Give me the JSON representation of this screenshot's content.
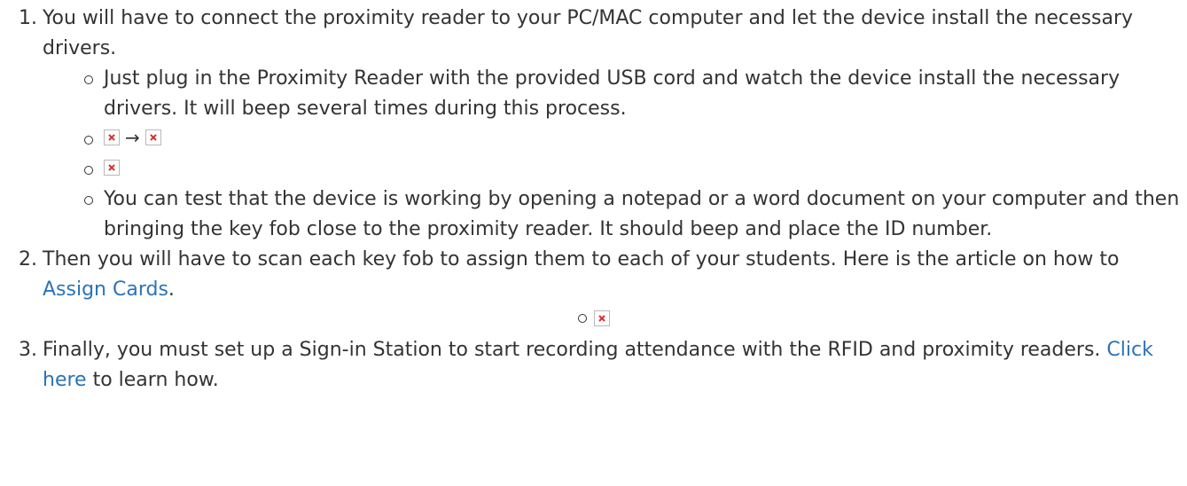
{
  "steps": [
    {
      "number": "1.",
      "text": "You will have to connect the proximity reader to your PC/MAC computer and let the device install the necessary drivers.",
      "subitems": {
        "plug_text": "Just plug in the Proximity Reader with the provided USB cord and watch the device install the necessary drivers. It will beep several times during this process.",
        "arrow": "→",
        "test_text": "You can test that the device is working by opening a notepad or a word document on your computer and then bringing the key fob close to the proximity reader. It should beep and place the ID number."
      }
    },
    {
      "number": "2.",
      "text_before": "Then you will have to scan each key fob to assign them to each of your students. Here is the article on how to ",
      "link": "Assign Cards",
      "text_after": "."
    },
    {
      "number": "3.",
      "text_before": "Finally, you must set up a Sign-in Station to start recording attendance with the RFID and proximity readers. ",
      "link": "Click here",
      "text_after": " to learn how."
    }
  ],
  "colors": {
    "text": "#333333",
    "link": "#2b73b7",
    "broken_image_x": "#d9302c"
  },
  "icons": {
    "broken_image": "broken-image-icon",
    "bullet": "hollow-circle-bullet"
  }
}
